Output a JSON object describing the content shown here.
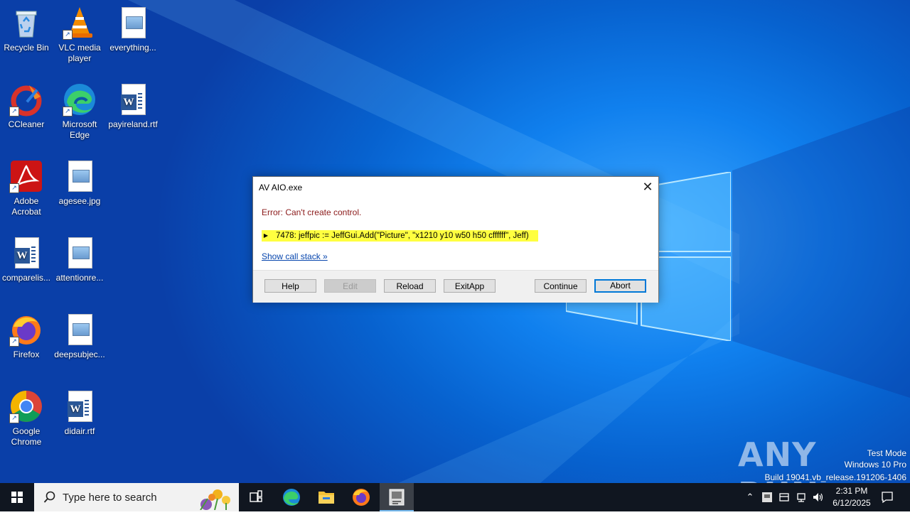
{
  "desktop": {
    "icons": [
      {
        "label": "Recycle Bin"
      },
      {
        "label": "VLC media player"
      },
      {
        "label": "everything..."
      },
      {
        "label": "CCleaner"
      },
      {
        "label": "Microsoft Edge"
      },
      {
        "label": "payireland.rtf"
      },
      {
        "label": "Adobe Acrobat"
      },
      {
        "label": "agesee.jpg"
      },
      {
        "label": "comparelis..."
      },
      {
        "label": "attentionre..."
      },
      {
        "label": "Firefox"
      },
      {
        "label": "deepsubjec..."
      },
      {
        "label": "Google Chrome"
      },
      {
        "label": "didair.rtf"
      }
    ]
  },
  "dialog": {
    "title": "AV AIO.exe",
    "close_icon": "close-icon",
    "error": "Error: Can't create control.",
    "code_line": "7478: jeffpic := JeffGui.Add(\"Picture\", \"x1210 y10 w50 h50  cffffff\", Jeff)",
    "link": "Show call stack »",
    "buttons": {
      "help": "Help",
      "edit": "Edit",
      "reload": "Reload",
      "exitapp": "ExitApp",
      "continue": "Continue",
      "abort": "Abort"
    }
  },
  "watermark": {
    "brand": "ANY RUN",
    "mode": "Test Mode",
    "os": "Windows 10 Pro",
    "build": "Build 19041.vb_release.191206-1406"
  },
  "taskbar": {
    "search_placeholder": "Type here to search",
    "time": "2:31 PM",
    "date": "6/12/2025"
  },
  "colors": {
    "accent": "#0078d7",
    "error_text": "#8b1a1a",
    "highlight": "#ffff40",
    "link": "#0645ad",
    "taskbar": "#101620"
  }
}
